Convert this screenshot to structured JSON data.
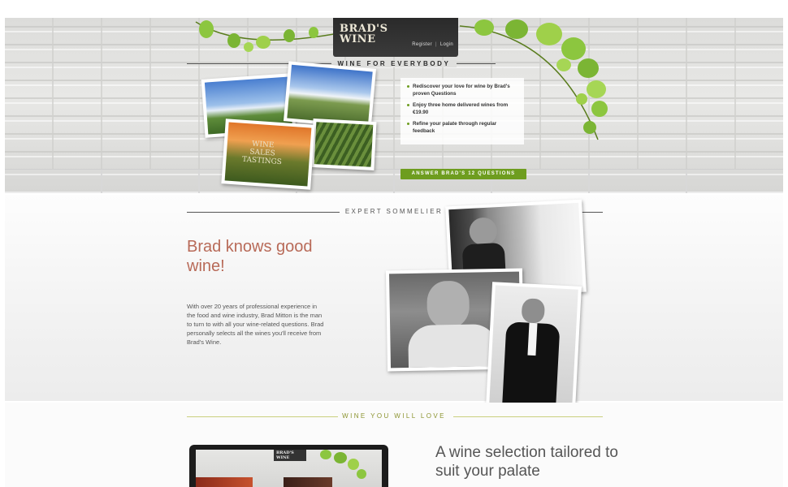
{
  "header": {
    "logo_text": "BRAD'S WINE",
    "register_label": "Register",
    "login_label": "Login",
    "separator": "|",
    "tagline": "WINE FOR EVERYBODY"
  },
  "hero": {
    "bullets": [
      "Rediscover your love for wine by Brad's proven Questions",
      "Enjoy three home delivered wines from €19.90",
      "Refine your palate through regular feedback"
    ],
    "cta_label": "ANSWER BRAD'S 12 QUESTIONS",
    "photo_sign_text": "WINE SALES TASTINGS"
  },
  "sommelier": {
    "section_label": "EXPERT SOMMELIER",
    "title": "Brad knows good wine!",
    "body": "With over 20 years of professional experience in the food and wine industry, Brad Mitton is the man to turn to with all your wine-related questions. Brad personally selects all the wines you'll receive from Brad's Wine."
  },
  "selection": {
    "section_label": "WINE YOU WILL LOVE",
    "title": "A wine selection tailored to suit your palate"
  },
  "colors": {
    "accent_green": "#6e9d1f",
    "title_rose": "#b86a58",
    "olive_label": "#8c9430"
  }
}
